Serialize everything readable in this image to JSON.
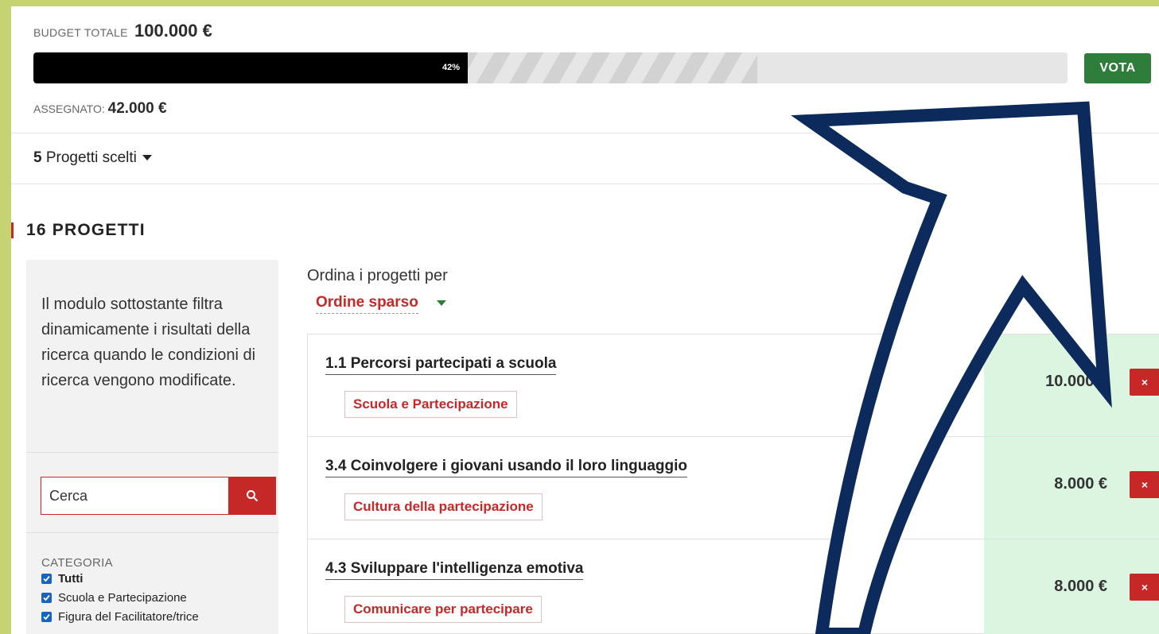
{
  "budget": {
    "label": "BUDGET TOTALE",
    "total": "100.000 €",
    "progress_fraction": 0.42,
    "progress_text": "42%",
    "assigned_label": "ASSEGNATO:",
    "assigned_value": "42.000 €"
  },
  "vote_button": "VOTA",
  "chosen": {
    "count": "5",
    "label": "Progetti scelti"
  },
  "section": {
    "title": "16 PROGETTI"
  },
  "sidebar": {
    "description": "Il modulo sottostante filtra dinamicamente i risultati della ricerca quando le condizioni di ricerca vengono modificate.",
    "search_placeholder": "Cerca",
    "category_label": "CATEGORIA",
    "categories": [
      {
        "label": "Tutti",
        "checked": true
      },
      {
        "label": "Scuola e Partecipazione",
        "checked": true
      },
      {
        "label": "Figura del Facilitatore/trice",
        "checked": true
      }
    ]
  },
  "sort": {
    "label": "Ordina i progetti per",
    "selected": "Ordine sparso"
  },
  "projects": [
    {
      "title": "1.1 Percorsi partecipati a scuola",
      "tag": "Scuola e Partecipazione",
      "amount": "10.000 €",
      "remove": "×"
    },
    {
      "title": "3.4 Coinvolgere i giovani usando il loro linguaggio",
      "tag": "Cultura della partecipazione",
      "amount": "8.000 €",
      "remove": "×"
    },
    {
      "title": "4.3 Sviluppare l'intelligenza emotiva",
      "tag": "Comunicare per partecipare",
      "amount": "8.000 €",
      "remove": "×"
    }
  ],
  "colors": {
    "accent": "#c62828",
    "vote": "#2e7d3a",
    "arrow": "#0d2a5c",
    "frame": "#c5d373",
    "selected_bg": "#dcf5e1"
  }
}
